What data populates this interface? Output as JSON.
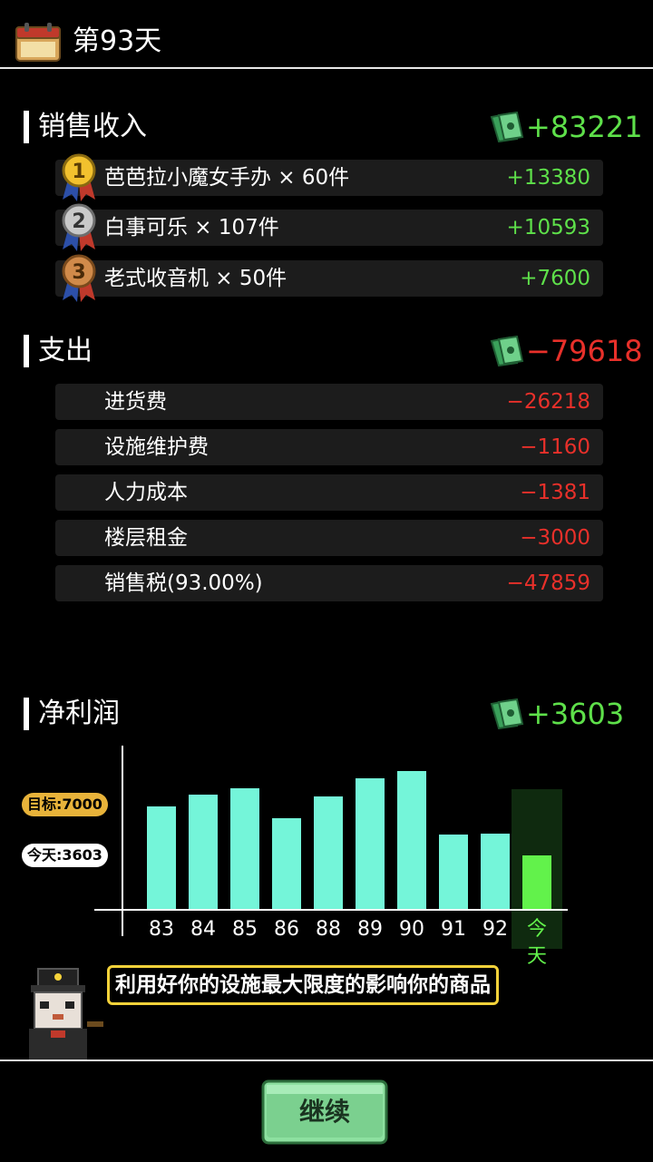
{
  "header": {
    "title": "第93天"
  },
  "sales": {
    "title": "销售收入",
    "total": "+83221",
    "items": [
      {
        "label": "芭芭拉小魔女手办 × 60件",
        "value": "+13380",
        "rank": "1"
      },
      {
        "label": "白事可乐 × 107件",
        "value": "+10593",
        "rank": "2"
      },
      {
        "label": "老式收音机 × 50件",
        "value": "+7600",
        "rank": "3"
      }
    ]
  },
  "expense": {
    "title": "支出",
    "total": "−79618",
    "items": [
      {
        "label": "进货费",
        "value": "−26218"
      },
      {
        "label": "设施维护费",
        "value": "−1160"
      },
      {
        "label": "人力成本",
        "value": "−1381"
      },
      {
        "label": "楼层租金",
        "value": "−3000"
      },
      {
        "label": "销售税(93.00%)",
        "value": "−47859"
      }
    ]
  },
  "profit": {
    "title": "净利润",
    "total": "+3603",
    "target_label": "目标:7000",
    "today_label": "今天:3603"
  },
  "chart_data": {
    "type": "bar",
    "categories": [
      "83",
      "84",
      "85",
      "86",
      "88",
      "89",
      "90",
      "91",
      "92",
      "今天"
    ],
    "values": [
      6900,
      7700,
      8100,
      6100,
      7600,
      8800,
      9300,
      5000,
      5100,
      3603
    ],
    "target": 7000,
    "ylim": [
      0,
      11000
    ],
    "colors": {
      "bar": "#74f5d9",
      "today": "#62f24b"
    }
  },
  "tip": {
    "text": "利用好你的设施最大限度的影响你的商品"
  },
  "footer": {
    "continue_label": "继续"
  },
  "colors": {
    "positive": "#5ee04a",
    "negative": "#e8302a",
    "accent": "#f4d23a"
  }
}
